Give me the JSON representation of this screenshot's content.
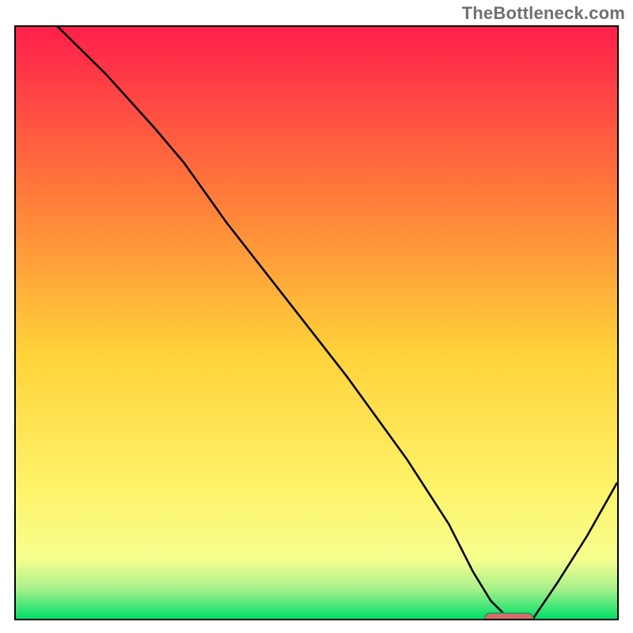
{
  "watermark": "TheBottleneck.com",
  "colors": {
    "frame": "#000000",
    "curve": "#000000",
    "marker_fill": "#d96a6f",
    "marker_stroke": "#2aa056",
    "grad_top": "#ff1f4b",
    "grad_mid1": "#ff7a3a",
    "grad_mid2": "#ffd23a",
    "grad_low": "#fff36a",
    "grad_band_top": "#f6ff8f",
    "grad_band_mid": "#a6f08b",
    "grad_bottom": "#00e06a"
  },
  "chart_data": {
    "type": "line",
    "title": "",
    "xlabel": "",
    "ylabel": "",
    "xlim": [
      0,
      100
    ],
    "ylim": [
      0,
      100
    ],
    "grid": false,
    "legend": false,
    "series": [
      {
        "name": "curve",
        "x": [
          0,
          7,
          15,
          23,
          28,
          35,
          45,
          55,
          65,
          72,
          76,
          79,
          82,
          86,
          90,
          95,
          100
        ],
        "y": [
          105,
          100,
          92,
          83,
          77,
          67,
          54,
          41,
          27,
          16,
          8,
          3,
          0,
          0,
          6,
          14,
          23
        ]
      }
    ],
    "marker": {
      "x_start": 78,
      "x_end": 86,
      "y": 0
    },
    "annotations": []
  }
}
